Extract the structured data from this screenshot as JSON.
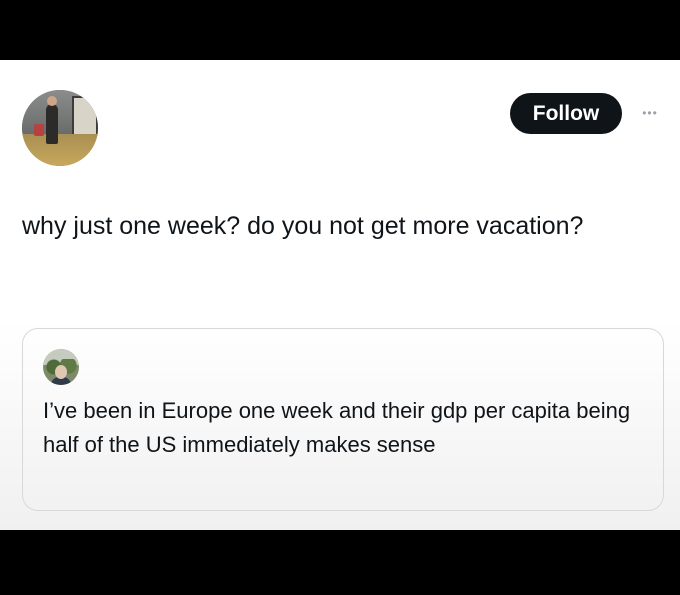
{
  "post": {
    "follow_label": "Follow",
    "more_icon": "more-horizontal-icon",
    "text": "why just one week? do you not get more vacation?"
  },
  "quoted_post": {
    "text": "I’ve been in Europe one week and their gdp per capita being half of the US immediately makes sense"
  },
  "colors": {
    "background_frame": "#000000",
    "post_background": "#ffffff",
    "follow_button_bg": "#0f1419",
    "follow_button_text": "#ffffff",
    "text_primary": "#0f1419",
    "card_border": "#d6d9db"
  }
}
